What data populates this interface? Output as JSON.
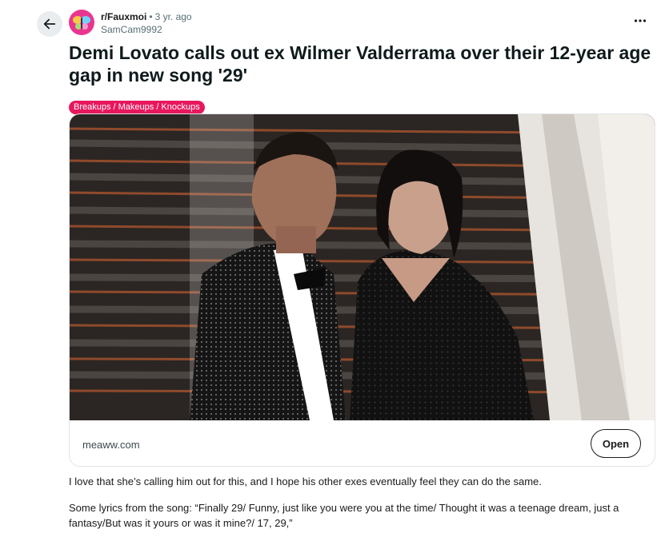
{
  "post": {
    "subreddit": "r/Fauxmoi",
    "separator": "•",
    "age": "3 yr. ago",
    "author": "SamCam9992",
    "title": "Demi Lovato calls out ex Wilmer Valderrama over their 12-year age gap in new song '29'",
    "flair": "Breakups / Makeups / Knockups"
  },
  "link": {
    "domain": "meaww.com",
    "open_label": "Open"
  },
  "body": {
    "paragraphs": [
      "I love that she’s calling him out for this, and I hope his other exes eventually feel they can do the same.",
      "Some lyrics from the song: “Finally 29/ Funny, just like you were you at the time/ Thought it was a teenage dream, just a fantasy/But was it yours or was it mine?/ 17, 29,”"
    ]
  },
  "icons": {
    "back": "arrow-left-icon",
    "more": "ellipsis-icon",
    "avatar": "subreddit-avatar"
  },
  "colors": {
    "flair_bg": "#e8175d",
    "avatar_bg": "#e8368f",
    "back_bg": "#eaedef"
  }
}
